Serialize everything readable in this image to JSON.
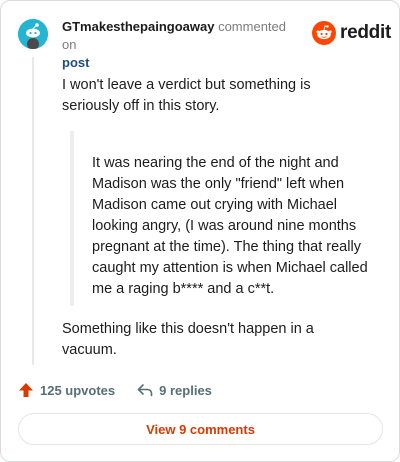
{
  "comment": {
    "author": "GTmakesthepaingoaway",
    "action": "commented on",
    "post_link": "post",
    "brand": "reddit",
    "paragraphs": {
      "intro": "I won't leave a verdict but something is seriously off in this story.",
      "quote": "It was nearing the end of the night and Madison was the only \"friend\" left when Madison came out crying with Michael looking angry, (I was around nine months pregnant at the time). The thing that really caught my attention is when Michael called me a raging b**** and a c**t.",
      "closing": "Something like this doesn't happen in a vacuum."
    }
  },
  "footer": {
    "upvotes": "125 upvotes",
    "replies": "9 replies",
    "view_comments": "View 9 comments"
  },
  "colors": {
    "brand": "#ff4500",
    "upvote": "#d93a00",
    "link": "#1c4f87"
  }
}
